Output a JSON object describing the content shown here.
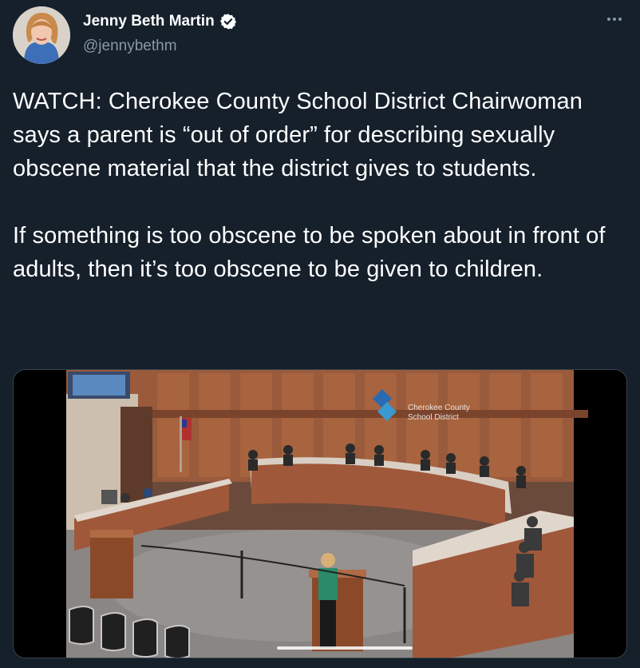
{
  "author": {
    "display_name": "Jenny Beth Martin",
    "handle": "@jennybethm",
    "verified": true,
    "more_icon": "more-horizontal-icon"
  },
  "tweet": {
    "paragraph_1": "WATCH: Cherokee County School District Chairwoman says a parent is “out of order” for describing sexually obscene material that the district gives to students.",
    "paragraph_2": "If something is too obscene to be spoken about in front of adults, then it’s too obscene to be given to children."
  },
  "media": {
    "type": "video",
    "sign_line_1": "Cherokee County",
    "sign_line_2": "School District"
  },
  "colors": {
    "background": "#15202b",
    "verified_badge": "#ffffff",
    "secondary_text": "#8899a6"
  }
}
